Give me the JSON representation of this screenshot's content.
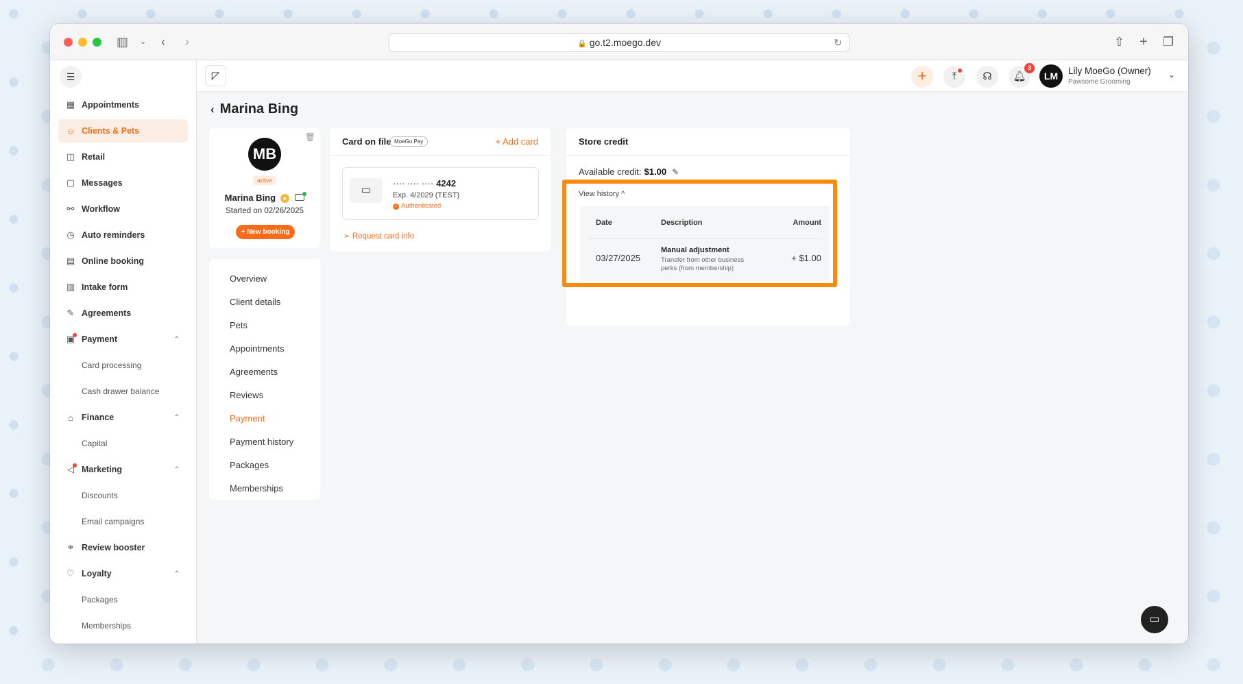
{
  "browser": {
    "url": "go.t2.moego.dev"
  },
  "sidebar": {
    "items": [
      {
        "label": "Appointments",
        "icon": "calendar-icon",
        "type": "item"
      },
      {
        "label": "Clients & Pets",
        "icon": "client-icon",
        "type": "item",
        "active": true
      },
      {
        "label": "Retail",
        "icon": "bag-icon",
        "type": "item"
      },
      {
        "label": "Messages",
        "icon": "message-icon",
        "type": "item"
      },
      {
        "label": "Workflow",
        "icon": "workflow-icon",
        "type": "item"
      },
      {
        "label": "Auto reminders",
        "icon": "alarm-icon",
        "type": "item"
      },
      {
        "label": "Online booking",
        "icon": "booking-icon",
        "type": "item"
      },
      {
        "label": "Intake form",
        "icon": "form-icon",
        "type": "item"
      },
      {
        "label": "Agreements",
        "icon": "pen-icon",
        "type": "item"
      },
      {
        "label": "Payment",
        "icon": "payment-icon",
        "type": "group",
        "dot": true
      },
      {
        "label": "Card processing",
        "type": "sub"
      },
      {
        "label": "Cash drawer balance",
        "type": "sub"
      },
      {
        "label": "Finance",
        "icon": "bank-icon",
        "type": "group"
      },
      {
        "label": "Capital",
        "type": "sub"
      },
      {
        "label": "Marketing",
        "icon": "megaphone-icon",
        "type": "group",
        "dot": true
      },
      {
        "label": "Discounts",
        "type": "sub"
      },
      {
        "label": "Email campaigns",
        "type": "sub"
      },
      {
        "label": "Review booster",
        "icon": "review-icon",
        "type": "item"
      },
      {
        "label": "Loyalty",
        "icon": "loyalty-icon",
        "type": "group"
      },
      {
        "label": "Packages",
        "type": "sub"
      },
      {
        "label": "Memberships",
        "type": "sub"
      }
    ]
  },
  "topbar": {
    "notification_count": "3",
    "user_initials": "LM",
    "user_name": "Lily MoeGo (Owner)",
    "business": "Pawsome Grooming"
  },
  "page": {
    "back": "‹",
    "title": "Marina Bing"
  },
  "profile": {
    "initials": "MB",
    "status": "active",
    "name": "Marina Bing",
    "started": "Started on 02/26/2025",
    "new_booking": "+ New booking"
  },
  "client_menu": [
    {
      "label": "Overview"
    },
    {
      "label": "Client details"
    },
    {
      "label": "Pets"
    },
    {
      "label": "Appointments"
    },
    {
      "label": "Agreements"
    },
    {
      "label": "Reviews"
    },
    {
      "label": "Payment",
      "active": true
    },
    {
      "label": "Payment history"
    },
    {
      "label": "Packages"
    },
    {
      "label": "Memberships"
    }
  ],
  "card_on_file": {
    "title": "Card on file",
    "pill": "MoeGo Pay",
    "add_card": "+ Add card",
    "masked": "···· ···· ····",
    "last4": "4242",
    "exp": "Exp. 4/2029 (TEST)",
    "auth": "Authenticated",
    "request": "Request card info"
  },
  "store_credit": {
    "title": "Store credit",
    "available_label": "Available credit:",
    "available_value": "$1.00",
    "view_history": "View history ^",
    "columns": {
      "date": "Date",
      "description": "Description",
      "amount": "Amount"
    },
    "rows": [
      {
        "date": "03/27/2025",
        "description": "Manual adjustment",
        "detail": "Transfer from other business perks (from membership)",
        "amount": "+ $1.00"
      }
    ]
  },
  "colors": {
    "accent": "#f96b18",
    "highlight": "#fb8a0d"
  }
}
